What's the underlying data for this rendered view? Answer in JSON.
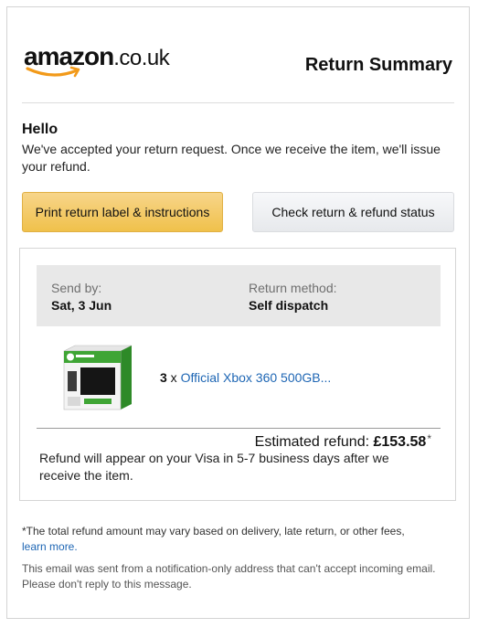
{
  "brand": {
    "name": "amazon",
    "suffix": ".co.uk",
    "smile_color": "#f29a1a"
  },
  "header": {
    "title": "Return Summary"
  },
  "greeting": "Hello",
  "intro": "We've accepted your return request. Once we receive the item, we'll issue your refund.",
  "buttons": {
    "print_label": "Print return label & instructions",
    "check_status": "Check return & refund status"
  },
  "summary": {
    "send_by_label": "Send by:",
    "send_by_value": "Sat, 3 Jun",
    "method_label": "Return method:",
    "method_value": "Self dispatch"
  },
  "item": {
    "quantity": "3",
    "multiplier": " x ",
    "title": "Official Xbox 360 500GB...",
    "image_icon": "xbox-360-box-icon"
  },
  "refund": {
    "label": "Estimated refund: ",
    "amount": "£153.58",
    "footnote_mark": "*",
    "note": "Refund will appear on your Visa in 5-7 business days after we receive the item."
  },
  "footer": {
    "disclaimer": "*The total refund amount may vary based on delivery, late return, or other fees,",
    "learn_more": "learn more.",
    "no_reply": "This email was sent from a notification-only address that can't accept incoming email. Please don't reply to this message."
  },
  "colors": {
    "link": "#1e66b4",
    "primary_button": "#f0c14b",
    "info_band": "#e8e8e8",
    "xbox_green": "#3fa535"
  }
}
